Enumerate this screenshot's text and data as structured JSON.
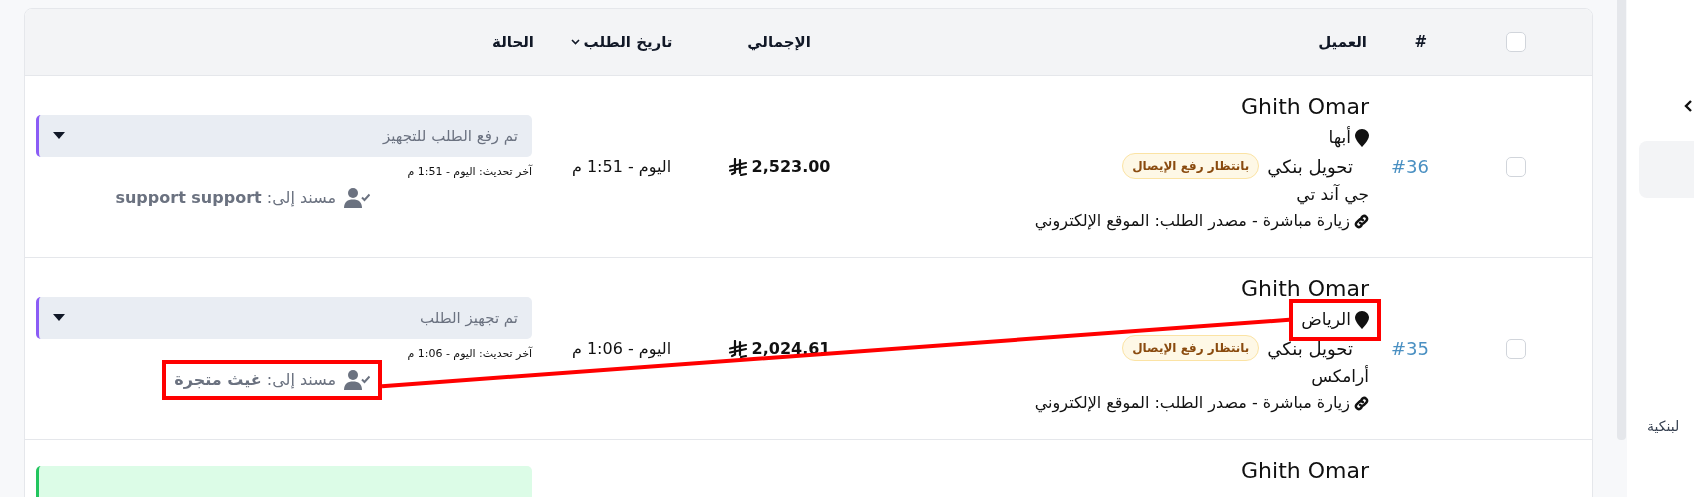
{
  "table": {
    "header_checkbox": {
      "checked": false
    },
    "columns": [
      {
        "label": "#"
      },
      {
        "label": "العميل"
      },
      {
        "label": "الإجمالي"
      },
      {
        "label": "تاريخ الطلب",
        "sortable": true
      },
      {
        "label": "الحالة"
      }
    ],
    "rows": [
      {
        "selected": false,
        "number": "#36",
        "customer_name": "Ghith Omar",
        "location": {
          "text": "أبها",
          "highlighted": false
        },
        "payment_method": "تحويل بنكي",
        "payment_badge": "بانتظار رفع الإيصال",
        "shipping_company": "جي آند تي",
        "source": "زيارة مباشرة - مصدر الطلب: الموقع الإلكتروني",
        "total": "2,523.00",
        "date": "اليوم - 1:51 م",
        "status": {
          "label": "تم رفع الطلب للتجهيز",
          "color": "#e9edf3"
        },
        "last_update": "آخر تحديث: اليوم - 1:51 م",
        "assignee": {
          "text": "مسند إلى: **support support**",
          "highlighted": false
        }
      },
      {
        "selected": false,
        "number": "#35",
        "customer_name": "Ghith Omar",
        "location": {
          "text": "الرياض",
          "highlighted": true
        },
        "payment_method": "تحويل بنكي",
        "payment_badge": "بانتظار رفع الإيصال",
        "shipping_company": "أرامكس",
        "source": "زيارة مباشرة - مصدر الطلب: الموقع الإلكتروني",
        "total": "2,024.61",
        "date": "اليوم - 1:06 م",
        "status": {
          "label": "تم تجهيز الطلب",
          "color": "#e9edf3"
        },
        "last_update": "آخر تحديث: اليوم - 1:06 م",
        "assignee": {
          "text": "مسند إلى: **غيث متجرة**",
          "highlighted": true
        }
      },
      {
        "customer_name": "Ghith Omar",
        "status": {
          "color": "#dcfce7"
        }
      }
    ]
  },
  "sidebar": {
    "items": [
      {
        "selected": true
      },
      {
        "label": "لبنكية",
        "selected": false
      }
    ]
  }
}
